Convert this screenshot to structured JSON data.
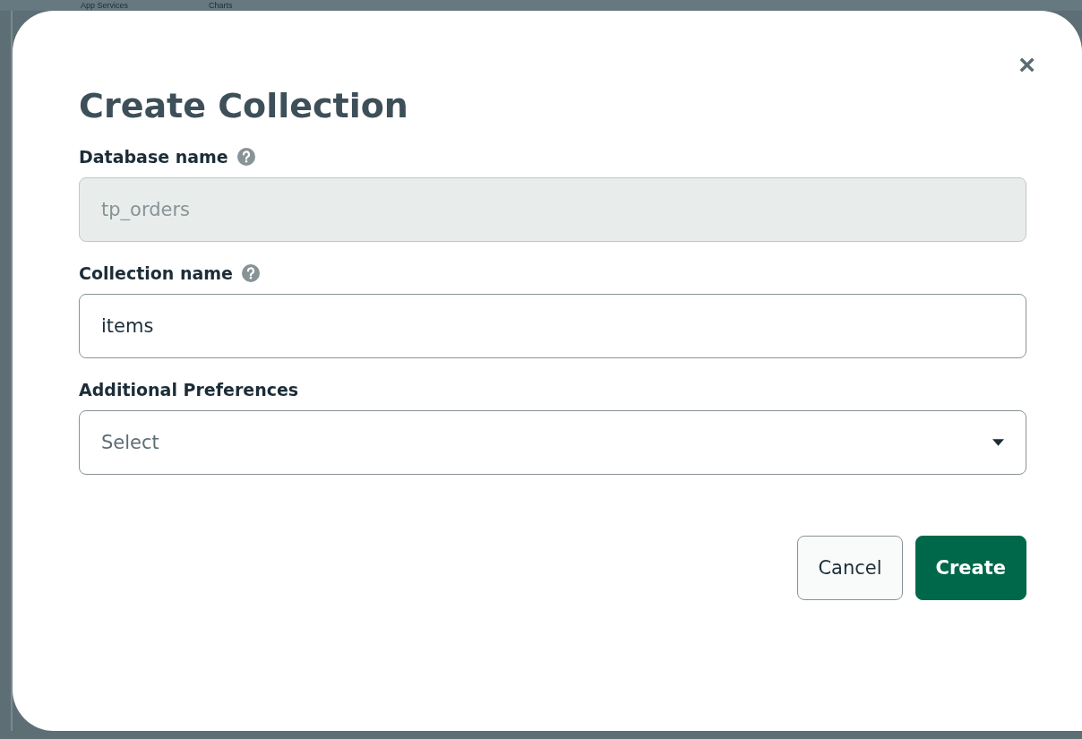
{
  "background_tabs": [
    {
      "label": "App Services"
    },
    {
      "label": "Charts"
    }
  ],
  "dialog": {
    "title": "Create Collection",
    "close": "×",
    "fields": [
      {
        "kind": "text",
        "label": "Database name",
        "help": true,
        "value": "tp_orders",
        "disabled": true
      },
      {
        "kind": "text",
        "label": "Collection name",
        "help": true,
        "value": "items",
        "disabled": false
      },
      {
        "kind": "select",
        "label": "Additional Preferences",
        "help": false,
        "placeholder": "Select"
      }
    ],
    "buttons": [
      {
        "label": "Cancel",
        "kind": "secondary"
      },
      {
        "label": "Create",
        "kind": "primary"
      }
    ]
  }
}
